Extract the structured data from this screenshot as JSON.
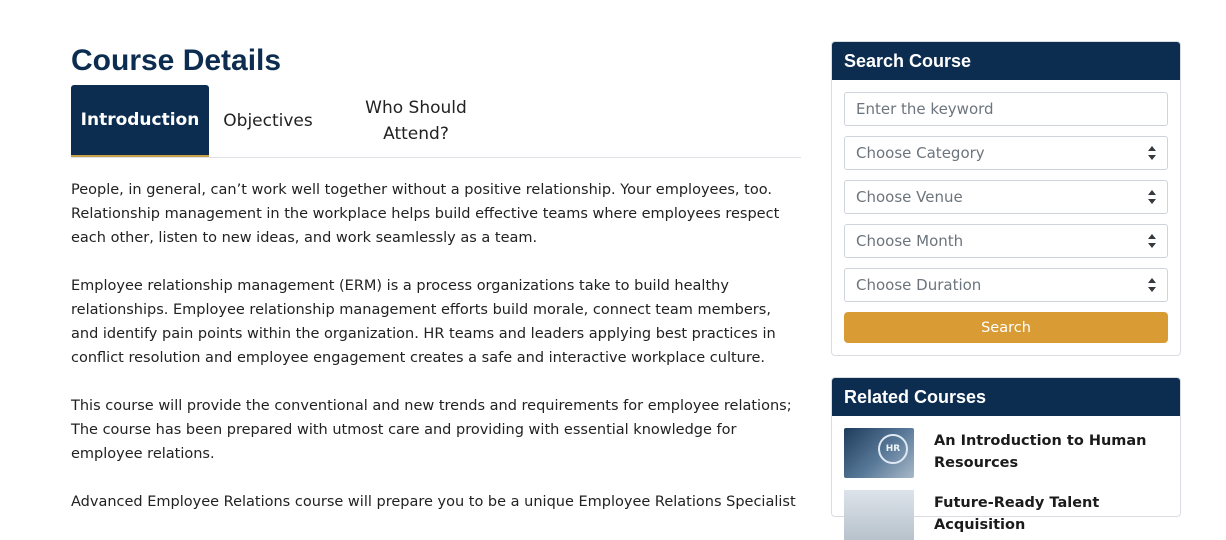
{
  "main": {
    "title": "Course Details",
    "tabs": [
      {
        "label": "Introduction"
      },
      {
        "label": "Objectives"
      },
      {
        "label": "Who Should Attend?"
      }
    ],
    "paragraphs": [
      "People, in general, can’t work well together without a positive relationship. Your employees, too. Relationship management in the workplace helps build effective teams where employees respect each other, listen to new ideas, and work seamlessly as a team.",
      "Employee relationship management (ERM) is a process organizations take to build healthy relationships. Employee relationship management efforts build morale, connect team members, and identify pain points within the organization. HR teams and leaders applying best practices in conflict resolution and employee engagement creates a safe and interactive workplace culture.",
      "This course will provide the conventional and new trends and requirements for employee relations; The course has been prepared with utmost care and providing with essential knowledge for employee relations.",
      "Advanced Employee Relations course will prepare you to be a unique Employee Relations Specialist"
    ]
  },
  "search": {
    "title": "Search Course",
    "keyword_placeholder": "Enter the keyword",
    "category": "Choose Category",
    "venue": "Choose Venue",
    "month": "Choose Month",
    "duration": "Choose Duration",
    "button": "Search"
  },
  "related": {
    "title": "Related Courses",
    "items": [
      {
        "title": "An Introduction to Human Resources",
        "thumb_text": "HR"
      },
      {
        "title": "Future-Ready Talent Acquisition"
      }
    ]
  }
}
